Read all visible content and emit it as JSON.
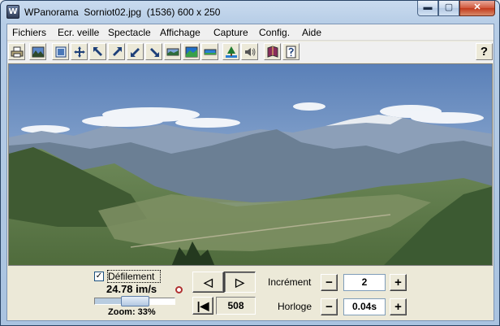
{
  "window": {
    "title": "WPanorama  Sorniot02.jpg  (1536) 600 x 250",
    "app_icon_letter": "W",
    "minimize_glyph": "▬",
    "maximize_glyph": "▢",
    "close_glyph": "✕"
  },
  "menu": {
    "items": [
      "Fichiers",
      "Ecr. veille",
      "Spectacle",
      "Affichage",
      "Capture",
      "Config.",
      "Aide"
    ]
  },
  "toolbar": {
    "buttons": [
      "print-icon",
      "landscape-image-icon",
      "fit-window-icon",
      "move-arrows-icon",
      "arrow-upleft-icon",
      "arrow-upright-icon",
      "arrow-downleft-icon",
      "arrow-downright-icon",
      "panorama-strip-icon",
      "panorama-icon",
      "panorama-flat-icon",
      "tree-icon",
      "speaker-icon",
      "book-icon",
      "help-page-icon"
    ],
    "help_label": "?"
  },
  "controls": {
    "scroll_checkbox_mark": "✓",
    "scroll_label": "Défilement",
    "speed": "24.78 im/s",
    "zoom_label": "Zoom: 33%",
    "zoom_fraction": 0.33,
    "prev_glyph": "◁",
    "next_glyph": "▷",
    "first_glyph": "|◀",
    "frame_number": "508",
    "increment_label": "Incrément",
    "increment_value": "2",
    "clock_label": "Horloge",
    "clock_value": "0.04s",
    "minus_glyph": "−",
    "plus_glyph": "+"
  },
  "colors": {
    "sky_top": "#5a80b8",
    "sky_bottom": "#b7cbe3",
    "mountain_far": "#8c9fb8",
    "mountain_mid": "#556a5e",
    "valley": "#5d7648",
    "foreground": "#3c5a32"
  }
}
